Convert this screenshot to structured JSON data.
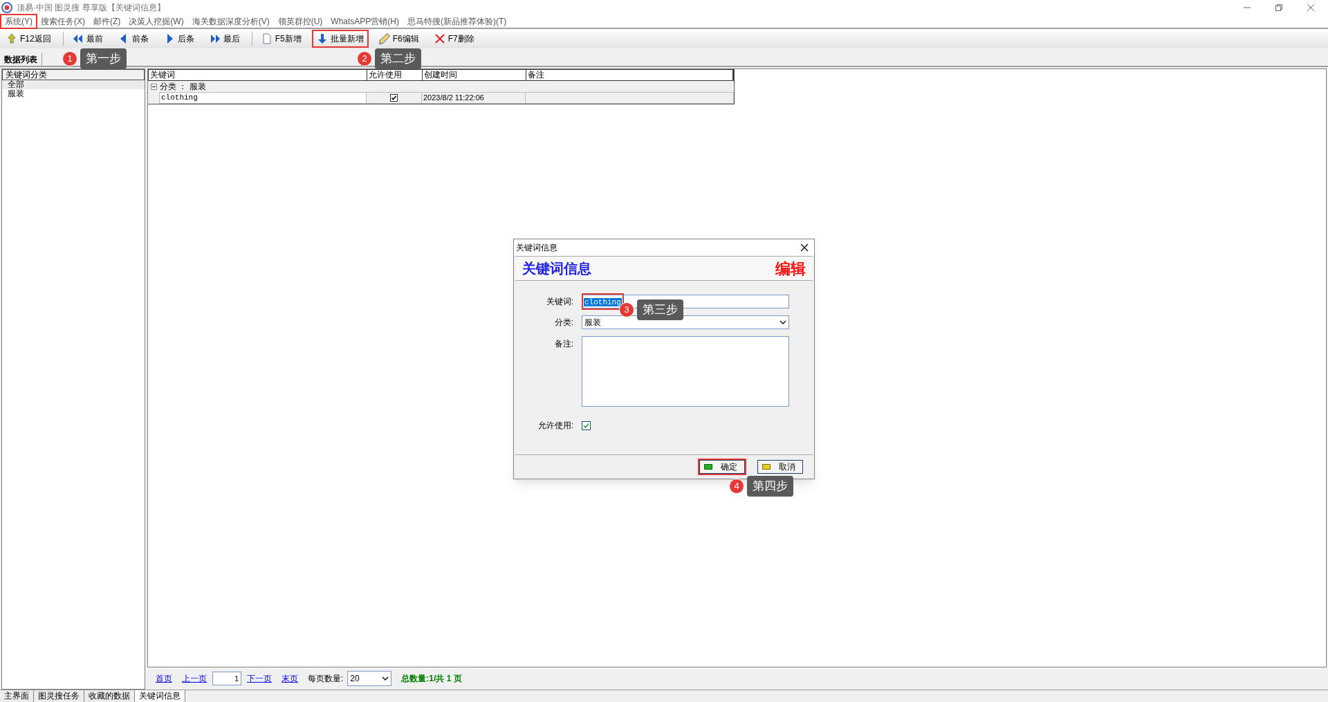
{
  "window": {
    "title": "顶易·中国 图灵搜 尊享版【关键词信息】"
  },
  "menu": [
    {
      "label": "系统(Y)",
      "highlighted": true
    },
    {
      "label": "搜索任务(X)",
      "highlighted": false
    },
    {
      "label": "邮件(Z)",
      "highlighted": false
    },
    {
      "label": "决策人挖掘(W)",
      "highlighted": false
    },
    {
      "label": "海关数据深度分析(V)",
      "highlighted": false
    },
    {
      "label": "领英群控(U)",
      "highlighted": false
    },
    {
      "label": "WhatsAPP营销(H)",
      "highlighted": false
    },
    {
      "label": "思马特搜(新品推荐体验)(T)",
      "highlighted": false
    }
  ],
  "toolbar": [
    {
      "label": "F12返回",
      "highlighted": false,
      "separator_after": true
    },
    {
      "label": "最前",
      "highlighted": false,
      "separator_after": false
    },
    {
      "label": "前条",
      "highlighted": false,
      "separator_after": false
    },
    {
      "label": "后条",
      "highlighted": false,
      "separator_after": false
    },
    {
      "label": "最后",
      "highlighted": false,
      "separator_after": true
    },
    {
      "label": "F5新增",
      "highlighted": false,
      "separator_after": false
    },
    {
      "label": "批量新增",
      "highlighted": true,
      "separator_after": false
    },
    {
      "label": "F6编辑",
      "highlighted": false,
      "separator_after": false
    },
    {
      "label": "F7删除",
      "highlighted": false,
      "separator_after": false
    }
  ],
  "list_tab": "数据列表",
  "sidebar": {
    "header": "关键词分类",
    "items": [
      {
        "label": "全部",
        "selected": true
      },
      {
        "label": "服装",
        "selected": false
      }
    ]
  },
  "table": {
    "columns": [
      "关键词",
      "允许使用",
      "创建时间",
      "备注"
    ],
    "group": {
      "label": "分类 ： 服装",
      "expanded": true
    },
    "rows": [
      {
        "keyword": "clothing",
        "allowed": true,
        "created": "2023/8/2 11:22:06"
      }
    ]
  },
  "pager": {
    "first": "首页",
    "prev": "上一页",
    "page": "1",
    "next": "下一页",
    "last": "末页",
    "per_page_label": "每页数量:",
    "per_page": "20",
    "summary": "总数量:1/共 1 页"
  },
  "bottom_tabs": [
    {
      "label": "主界面",
      "selected": false
    },
    {
      "label": "图灵搜任务",
      "selected": false
    },
    {
      "label": "收藏的数据",
      "selected": false
    },
    {
      "label": "关键词信息",
      "selected": true
    }
  ],
  "dialog": {
    "title": "关键词信息",
    "heading": "关键词信息",
    "mode": "编辑",
    "keyword_label": "关键词:",
    "keyword": "clothing",
    "keyword_highlighted": true,
    "category_label": "分类:",
    "category": "服装",
    "note_label": "备注:",
    "allowed_label": "允许使用:",
    "allowed": true,
    "ok": "确定",
    "ok_highlighted": true,
    "cancel": "取消"
  },
  "annotations": [
    {
      "number": "1",
      "text": "第一步"
    },
    {
      "number": "2",
      "text": "第二步"
    },
    {
      "number": "3",
      "text": "第三步"
    },
    {
      "number": "4",
      "text": "第四步"
    }
  ]
}
